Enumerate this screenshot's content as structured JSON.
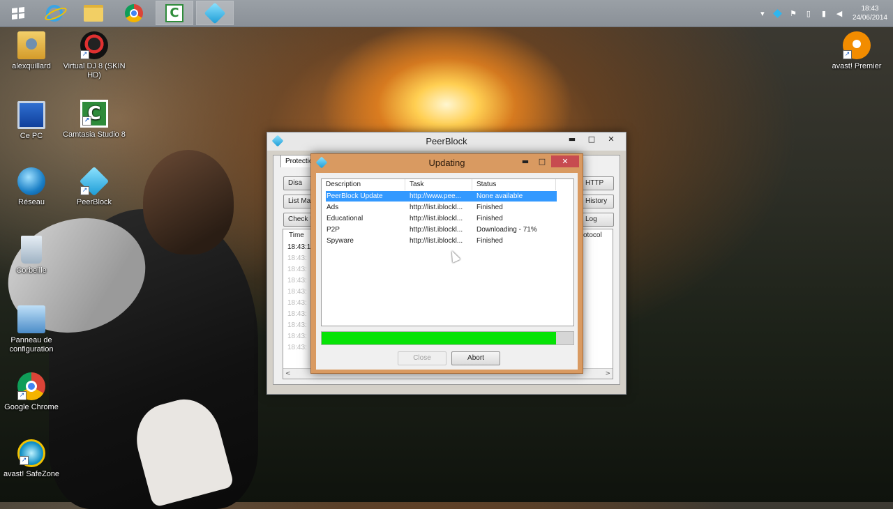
{
  "taskbar": {
    "apps": [
      "start",
      "internet-explorer",
      "file-explorer",
      "google-chrome",
      "camtasia",
      "peerblock"
    ],
    "tray_arrow": "▾",
    "clock": {
      "time": "18:43",
      "date": "24/06/2014"
    }
  },
  "desktop": {
    "icons": [
      {
        "label": "alexquillard",
        "icon": "user-folder-icon"
      },
      {
        "label": "Virtual DJ 8 (SKIN HD)",
        "icon": "virtualdj-icon"
      },
      {
        "label": "Ce PC",
        "icon": "computer-icon"
      },
      {
        "label": "Camtasia Studio 8",
        "icon": "camtasia-icon"
      },
      {
        "label": "Réseau",
        "icon": "network-icon"
      },
      {
        "label": "PeerBlock",
        "icon": "peerblock-icon"
      },
      {
        "label": "Corbeille",
        "icon": "recycle-bin-icon"
      },
      {
        "label": "Panneau de configuration",
        "icon": "control-panel-icon"
      },
      {
        "label": "Google Chrome",
        "icon": "chrome-icon"
      },
      {
        "label": "avast! SafeZone",
        "icon": "safezone-icon"
      },
      {
        "label": "avast! Premier",
        "icon": "avast-icon"
      }
    ]
  },
  "peerblock_window": {
    "title": "PeerBlock",
    "tab": "Protection",
    "buttons": {
      "disable": "Disa",
      "list_manager": "List Ma",
      "check_updates": "Check U",
      "http": "HTTP",
      "history": "History",
      "log": "Log"
    },
    "log_headers": {
      "time": "Time",
      "protocol": "otocol"
    },
    "log_rows": [
      "18:43:1",
      "18:43:",
      "18:43:",
      "18:43:",
      "18:43:",
      "18:43:",
      "18:43:",
      "18:43:",
      "18:43:",
      "18:43:"
    ],
    "scroll_left": "<",
    "scroll_right": ">"
  },
  "updating_dialog": {
    "title": "Updating",
    "columns": [
      "Description",
      "Task",
      "Status"
    ],
    "rows": [
      {
        "description": "PeerBlock Update",
        "task": "http://www.pee...",
        "status": "None available",
        "selected": true
      },
      {
        "description": "Ads",
        "task": "http://list.iblockl...",
        "status": "Finished",
        "selected": false
      },
      {
        "description": "Educational",
        "task": "http://list.iblockl...",
        "status": "Finished",
        "selected": false
      },
      {
        "description": "P2P",
        "task": "http://list.iblockl...",
        "status": "Downloading - 71%",
        "selected": false
      },
      {
        "description": "Spyware",
        "task": "http://list.iblockl...",
        "status": "Finished",
        "selected": false
      }
    ],
    "progress": 0.93,
    "close_label": "Close",
    "abort_label": "Abort"
  },
  "window_controls": {
    "minimize": "▬",
    "maximize": "□",
    "close": "✕"
  },
  "colors": {
    "progress": "#06e306",
    "dialog_frame": "#d99a61",
    "selection": "#3399ff",
    "close_button": "#c74b50"
  }
}
